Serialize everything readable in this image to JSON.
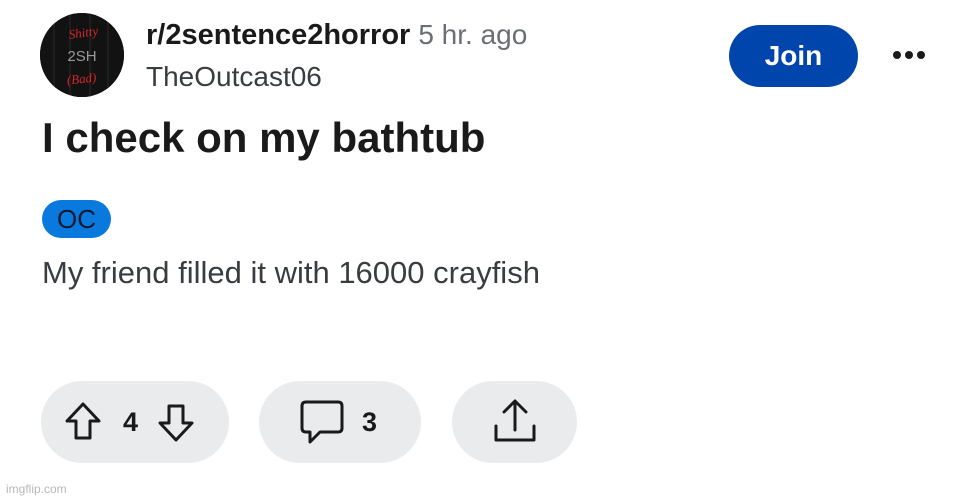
{
  "post": {
    "subreddit": "r/2sentence2horror",
    "time_ago": "5 hr. ago",
    "username": "TheOutcast06",
    "title": "I check on my bathtub",
    "flair": "OC",
    "body": "My friend filled it with 16000 crayfish"
  },
  "avatar": {
    "text_lines": [
      "Shitty",
      "2SH",
      "(Bad)"
    ],
    "colors": {
      "red": "#d8262a",
      "gray": "#9a9a9a",
      "background": "#111111"
    }
  },
  "header": {
    "join_label": "Join",
    "more_icon": "ellipsis-icon"
  },
  "actions": {
    "vote_count": "4",
    "comment_count": "3",
    "upvote_icon": "upvote-arrow-icon",
    "downvote_icon": "downvote-arrow-icon",
    "comment_icon": "comment-bubble-icon",
    "share_icon": "share-icon"
  },
  "watermark": "imgflip.com",
  "colors": {
    "join_button": "#0045ac",
    "flair_background": "#0a79de",
    "action_pill": "#e9ebed",
    "secondary_text": "#6b6f73"
  }
}
